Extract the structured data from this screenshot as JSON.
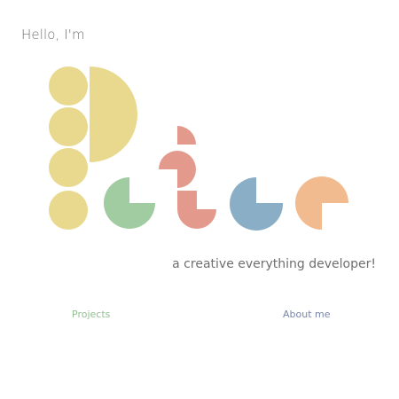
{
  "greeting": "Hello, I'm",
  "name_logo": "Peter",
  "tagline": "a creative everything developer!",
  "nav": {
    "projects_label": "Projects",
    "about_label": "About me"
  },
  "colors": {
    "yellow": "#e8d98e",
    "green": "#a1cba0",
    "salmon": "#e39a8c",
    "blue": "#8aaec6",
    "orange": "#f2bb8f",
    "text": "#6f6f6f",
    "projects_link": "#92bf91",
    "about_link": "#7a86a8"
  }
}
